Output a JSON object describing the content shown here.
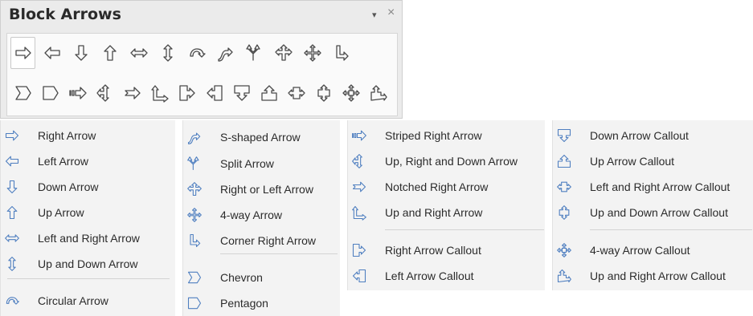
{
  "panel": {
    "title": "Block Arrows",
    "dropdown_glyph": "▾",
    "close_glyph": "×",
    "row1": [
      "right-arrow-icon",
      "left-arrow-icon",
      "down-arrow-icon",
      "up-arrow-icon",
      "left-right-arrow-icon",
      "up-down-arrow-icon",
      "circular-arrow-icon",
      "s-shaped-arrow-icon",
      "split-arrow-icon",
      "right-or-left-arrow-icon",
      "four-way-arrow-icon",
      "corner-right-arrow-icon"
    ],
    "row2": [
      "chevron-icon",
      "pentagon-icon",
      "striped-right-arrow-icon",
      "up-right-down-arrow-icon",
      "notched-right-arrow-icon",
      "up-and-right-arrow-icon",
      "right-arrow-callout-icon",
      "left-arrow-callout-icon",
      "down-arrow-callout-icon",
      "up-arrow-callout-icon",
      "left-right-arrow-callout-icon",
      "up-down-arrow-callout-icon",
      "four-way-arrow-callout-icon",
      "up-right-arrow-callout-icon"
    ]
  },
  "menu1": {
    "items": [
      {
        "label": "Right Arrow",
        "icon": "right-arrow-icon"
      },
      {
        "label": "Left Arrow",
        "icon": "left-arrow-icon"
      },
      {
        "label": "Down Arrow",
        "icon": "down-arrow-icon"
      },
      {
        "label": "Up Arrow",
        "icon": "up-arrow-icon"
      },
      {
        "label": "Left and Right Arrow",
        "icon": "left-right-arrow-icon"
      },
      {
        "label": "Up and Down Arrow",
        "icon": "up-down-arrow-icon"
      },
      {
        "label": "Circular Arrow",
        "icon": "circular-arrow-icon"
      }
    ]
  },
  "menu2": {
    "items": [
      {
        "label": "S-shaped Arrow",
        "icon": "s-shaped-arrow-icon"
      },
      {
        "label": "Split Arrow",
        "icon": "split-arrow-icon"
      },
      {
        "label": "Right or Left Arrow",
        "icon": "right-or-left-arrow-icon"
      },
      {
        "label": "4-way Arrow",
        "icon": "four-way-arrow-icon"
      },
      {
        "label": "Corner Right Arrow",
        "icon": "corner-right-arrow-icon"
      },
      {
        "label": "Chevron",
        "icon": "chevron-icon"
      },
      {
        "label": "Pentagon",
        "icon": "pentagon-icon"
      }
    ]
  },
  "menu3": {
    "items": [
      {
        "label": "Striped Right Arrow",
        "icon": "striped-right-arrow-icon"
      },
      {
        "label": "Up, Right and Down Arrow",
        "icon": "up-right-down-arrow-icon"
      },
      {
        "label": "Notched Right Arrow",
        "icon": "notched-right-arrow-icon"
      },
      {
        "label": "Up and Right Arrow",
        "icon": "up-and-right-arrow-icon"
      },
      {
        "label": "Right Arrow Callout",
        "icon": "right-arrow-callout-icon"
      },
      {
        "label": "Left Arrow Callout",
        "icon": "left-arrow-callout-icon"
      }
    ]
  },
  "menu4": {
    "items": [
      {
        "label": "Down Arrow Callout",
        "icon": "down-arrow-callout-icon"
      },
      {
        "label": "Up Arrow Callout",
        "icon": "up-arrow-callout-icon"
      },
      {
        "label": "Left and Right Arrow Callout",
        "icon": "left-right-arrow-callout-icon"
      },
      {
        "label": "Up and Down Arrow Callout",
        "icon": "up-down-arrow-callout-icon"
      },
      {
        "label": "4-way Arrow Callout",
        "icon": "four-way-arrow-callout-icon"
      },
      {
        "label": "Up and Right Arrow Callout",
        "icon": "up-right-arrow-callout-icon"
      }
    ]
  }
}
